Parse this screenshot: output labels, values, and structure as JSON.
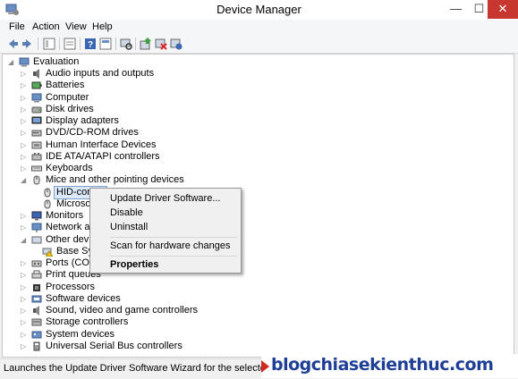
{
  "window": {
    "title": "Device Manager",
    "min_glyph": "—",
    "max_glyph": "☐",
    "close_glyph": "✕"
  },
  "menu": [
    "File",
    "Action",
    "View",
    "Help"
  ],
  "toolbar": [
    "back-icon",
    "forward-icon",
    "view-icon",
    "properties-icon",
    "help-icon",
    "view2-icon",
    "scan-hardware-icon",
    "update-driver-icon",
    "uninstall-icon",
    "disable-icon"
  ],
  "tree": {
    "root": "Evaluation",
    "items": [
      {
        "label": "Audio inputs and outputs",
        "icon": "speaker-icon"
      },
      {
        "label": "Batteries",
        "icon": "battery-icon"
      },
      {
        "label": "Computer",
        "icon": "computer-icon"
      },
      {
        "label": "Disk drives",
        "icon": "disk-icon"
      },
      {
        "label": "Display adapters",
        "icon": "display-icon"
      },
      {
        "label": "DVD/CD-ROM drives",
        "icon": "dvd-icon"
      },
      {
        "label": "Human Interface Devices",
        "icon": "hid-icon"
      },
      {
        "label": "IDE ATA/ATAPI controllers",
        "icon": "ide-icon"
      },
      {
        "label": "Keyboards",
        "icon": "keyboard-icon"
      },
      {
        "label": "Mice and other pointing devices",
        "icon": "mouse-icon"
      },
      {
        "label": "HID-compl",
        "icon": "mouse-icon",
        "child": true,
        "selected": true
      },
      {
        "label": "Microsof",
        "icon": "mouse-icon",
        "child": true
      },
      {
        "label": "Monitors",
        "icon": "monitor-icon"
      },
      {
        "label": "Network ada",
        "icon": "network-icon"
      },
      {
        "label": "Other device",
        "icon": "other-icon",
        "expanded": true
      },
      {
        "label": "Base Syst",
        "icon": "warning-device-icon",
        "child": true
      },
      {
        "label": "Ports (COM",
        "icon": "port-icon"
      },
      {
        "label": "Print queues",
        "icon": "printer-icon"
      },
      {
        "label": "Processors",
        "icon": "processor-icon"
      },
      {
        "label": "Software devices",
        "icon": "software-icon"
      },
      {
        "label": "Sound, video and game controllers",
        "icon": "sound-icon"
      },
      {
        "label": "Storage controllers",
        "icon": "storage-icon"
      },
      {
        "label": "System devices",
        "icon": "system-icon"
      },
      {
        "label": "Universal Serial Bus controllers",
        "icon": "usb-icon"
      }
    ]
  },
  "context_menu": {
    "update": "Update Driver Software...",
    "disable": "Disable",
    "uninstall": "Uninstall",
    "scan": "Scan for hardware changes",
    "properties": "Properties"
  },
  "status": "Launches the Update Driver Software Wizard for the selected device.",
  "watermark": "blogchiasekienthuc.com",
  "colors": {
    "close_button": "#c7372f",
    "selection": "#dbe8f7",
    "watermark": "#1f3f96",
    "watermark_arrow": "#d12b1f"
  }
}
